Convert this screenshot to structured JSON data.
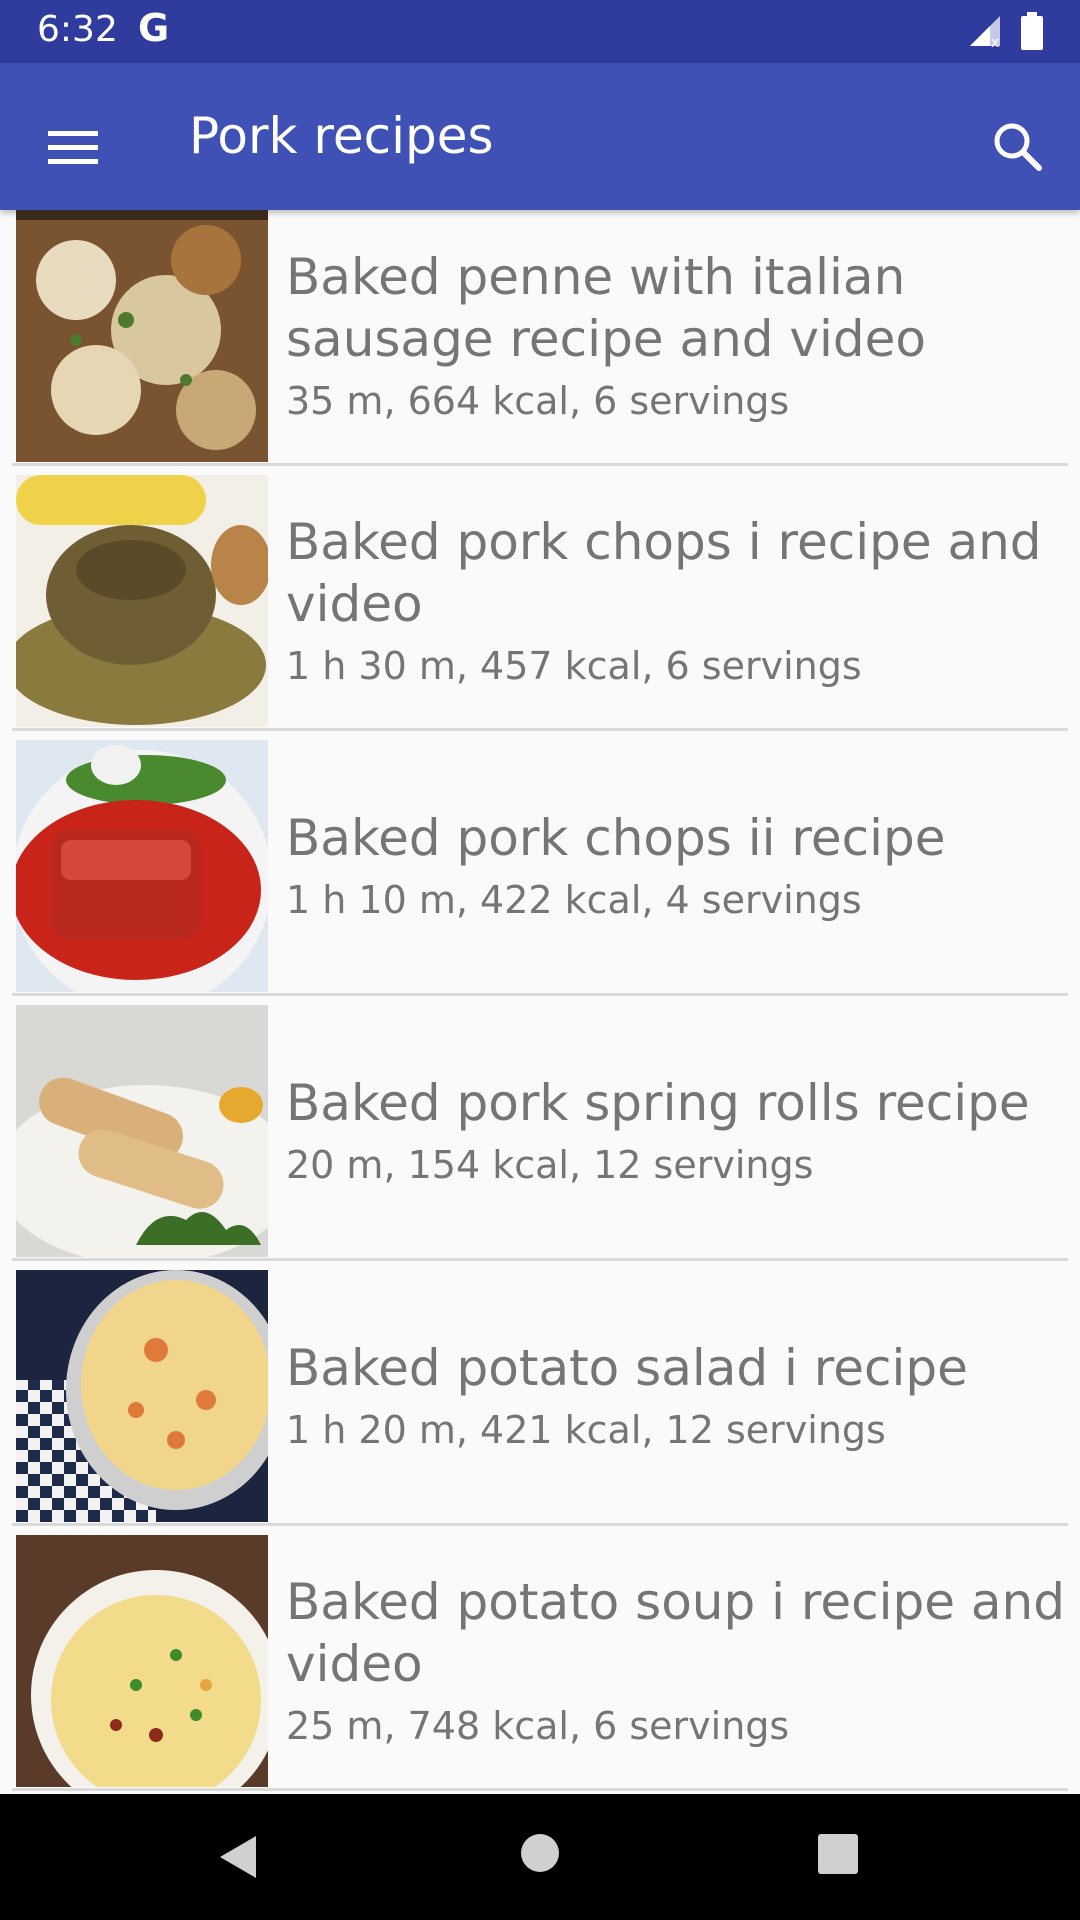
{
  "status_bar": {
    "time": "6:32",
    "notification_icon": "G",
    "signal_icon": "cell-signal-no-data-icon",
    "battery_icon": "battery-full-icon"
  },
  "app_bar": {
    "menu_icon": "hamburger-menu-icon",
    "title": "Pork recipes",
    "search_icon": "search-icon",
    "background_color": "#3f51b5"
  },
  "recipes": [
    {
      "title": "Baked penne with italian sausage recipe and video",
      "meta": "35 m, 664 kcal, 6 servings"
    },
    {
      "title": "Baked pork chops i recipe and video",
      "meta": "1 h 30 m, 457 kcal, 6 servings"
    },
    {
      "title": "Baked pork chops ii recipe",
      "meta": "1 h 10 m, 422 kcal, 4 servings"
    },
    {
      "title": "Baked pork spring rolls recipe",
      "meta": "20 m, 154 kcal, 12 servings"
    },
    {
      "title": "Baked potato salad i recipe",
      "meta": "1 h 20 m, 421 kcal, 12 servings"
    },
    {
      "title": "Baked potato soup i recipe and video",
      "meta": "25 m, 748 kcal, 6 servings"
    }
  ],
  "nav_bar": {
    "back_icon": "back-triangle-icon",
    "home_icon": "home-circle-icon",
    "recents_icon": "recents-square-icon"
  }
}
